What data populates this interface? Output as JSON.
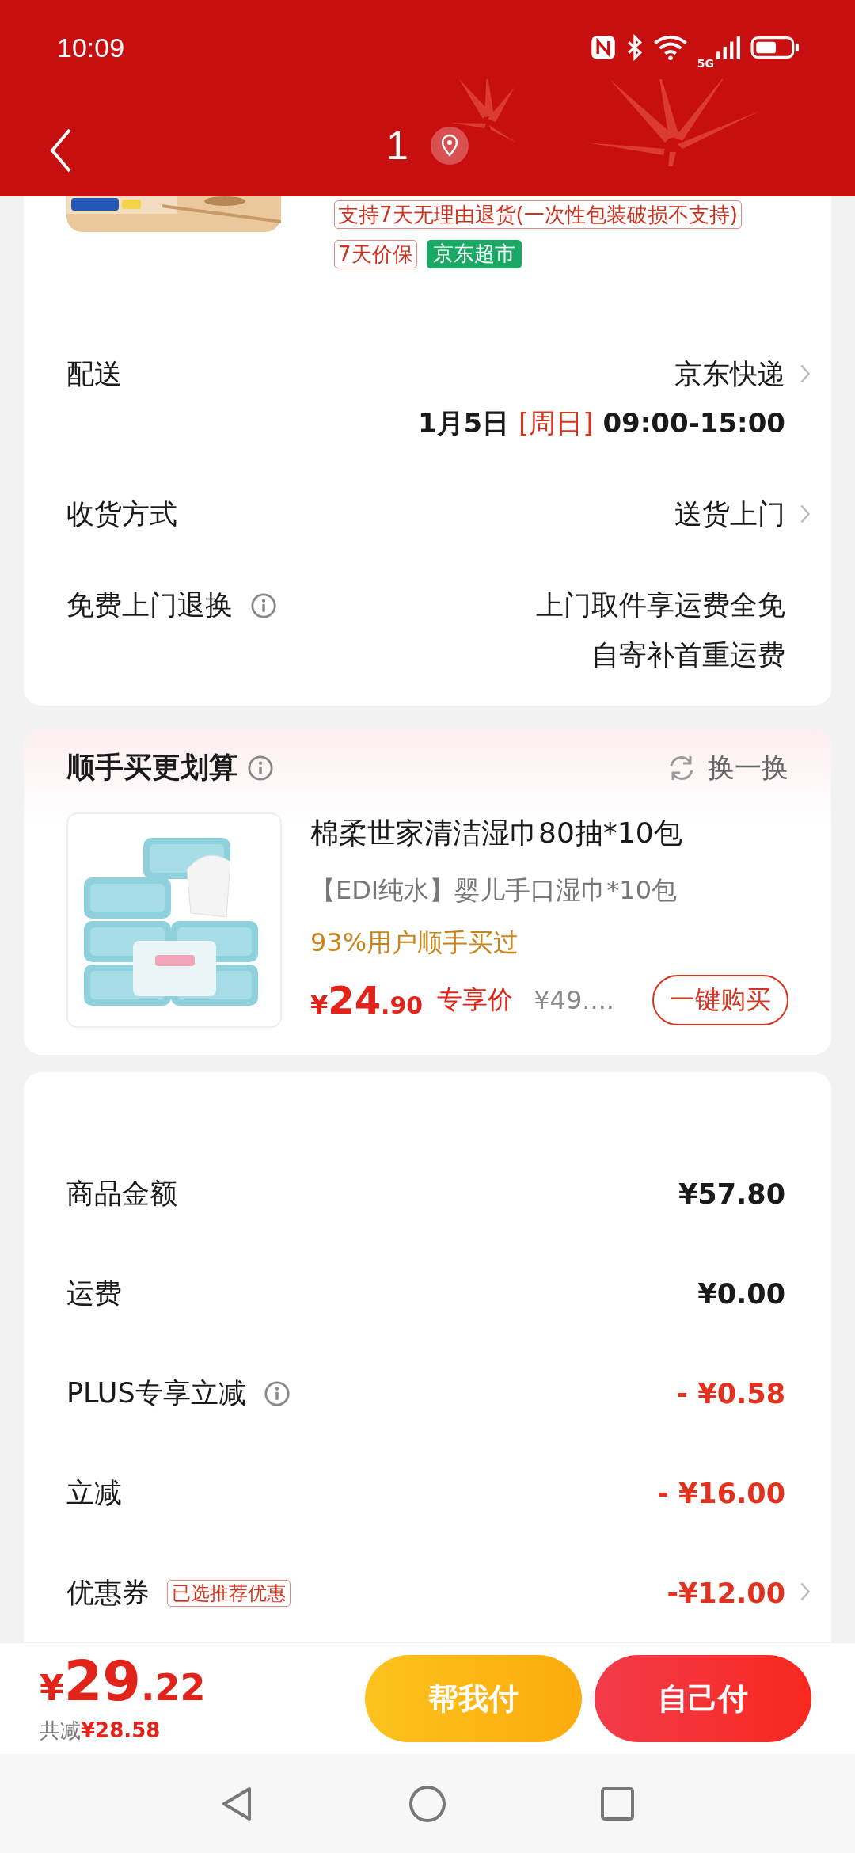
{
  "status_bar": {
    "time": "10:09",
    "network": "5G"
  },
  "header": {
    "title": "1"
  },
  "product": {
    "tags": [
      {
        "text": "支持7天无理由退货(一次性包装破损不支持)",
        "kind": "outline"
      },
      {
        "text": "7天价保",
        "kind": "outline"
      },
      {
        "text": "京东超市",
        "kind": "filled"
      }
    ]
  },
  "delivery": [
    {
      "label": "配送",
      "value": "京东快递",
      "chevron": true,
      "info": false,
      "schedule": {
        "date": "1月5日",
        "weekday": "[周日]",
        "time": "09:00-15:00"
      }
    },
    {
      "label": "收货方式",
      "value": "送货上门",
      "chevron": true,
      "info": false
    },
    {
      "label": "免费上门退换",
      "value": "上门取件享运费全免",
      "note": "自寄补首重运费",
      "chevron": false,
      "info": true
    }
  ],
  "recommend": {
    "title": "顺手买更划算",
    "refresh": "换一换",
    "item": {
      "name": "棉柔世家清洁湿巾80抽*10包",
      "subtitle": "【EDI纯水】婴儿手口湿巾*10包",
      "note": "93%用户顺手买过",
      "currency": "¥",
      "price_int": "24",
      "price_dec": ".90",
      "price_label": "专享价",
      "original_price": "¥49....",
      "buy": "一键购买"
    }
  },
  "summary": [
    {
      "label": "商品金额",
      "value": "¥57.80",
      "kind": "normal",
      "info": false,
      "chevron": false
    },
    {
      "label": "运费",
      "value": "¥0.00",
      "kind": "normal",
      "info": false,
      "chevron": false
    },
    {
      "label": "PLUS专享立减",
      "value": "- ¥0.58",
      "kind": "discount",
      "info": true,
      "chevron": false
    },
    {
      "label": "立减",
      "value": "- ¥16.00",
      "kind": "discount",
      "info": false,
      "chevron": false
    },
    {
      "label": "优惠券",
      "tag": "已选推荐优惠",
      "value": "-¥12.00",
      "kind": "discount",
      "info": false,
      "chevron": true
    }
  ],
  "footer": {
    "currency": "¥",
    "total_int": "29",
    "total_dec": ".22",
    "saved_label": "共减",
    "saved": "¥28.58",
    "buttons": [
      {
        "label": "帮我付",
        "kind": "secondary"
      },
      {
        "label": "自己付",
        "kind": "primary"
      }
    ]
  }
}
